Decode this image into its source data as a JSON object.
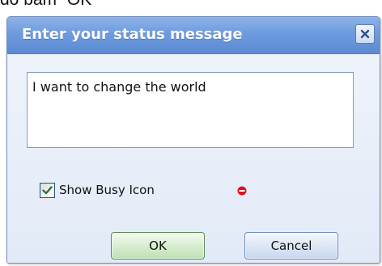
{
  "background_caption": "đó bấm “OK”",
  "dialog": {
    "title": "Enter your status message",
    "close_icon": "close-x-icon",
    "status_message": "I want to change the world",
    "show_busy_icon": {
      "label": "Show Busy Icon",
      "checked": true,
      "icon": "busy-red-dot-icon"
    },
    "buttons": {
      "ok": "OK",
      "cancel": "Cancel"
    }
  },
  "colors": {
    "title_bar": "#6d9bde",
    "busy_icon": "#e0101a",
    "ok_button": "#d6ecce",
    "checkmark": "#1f6b3a"
  }
}
